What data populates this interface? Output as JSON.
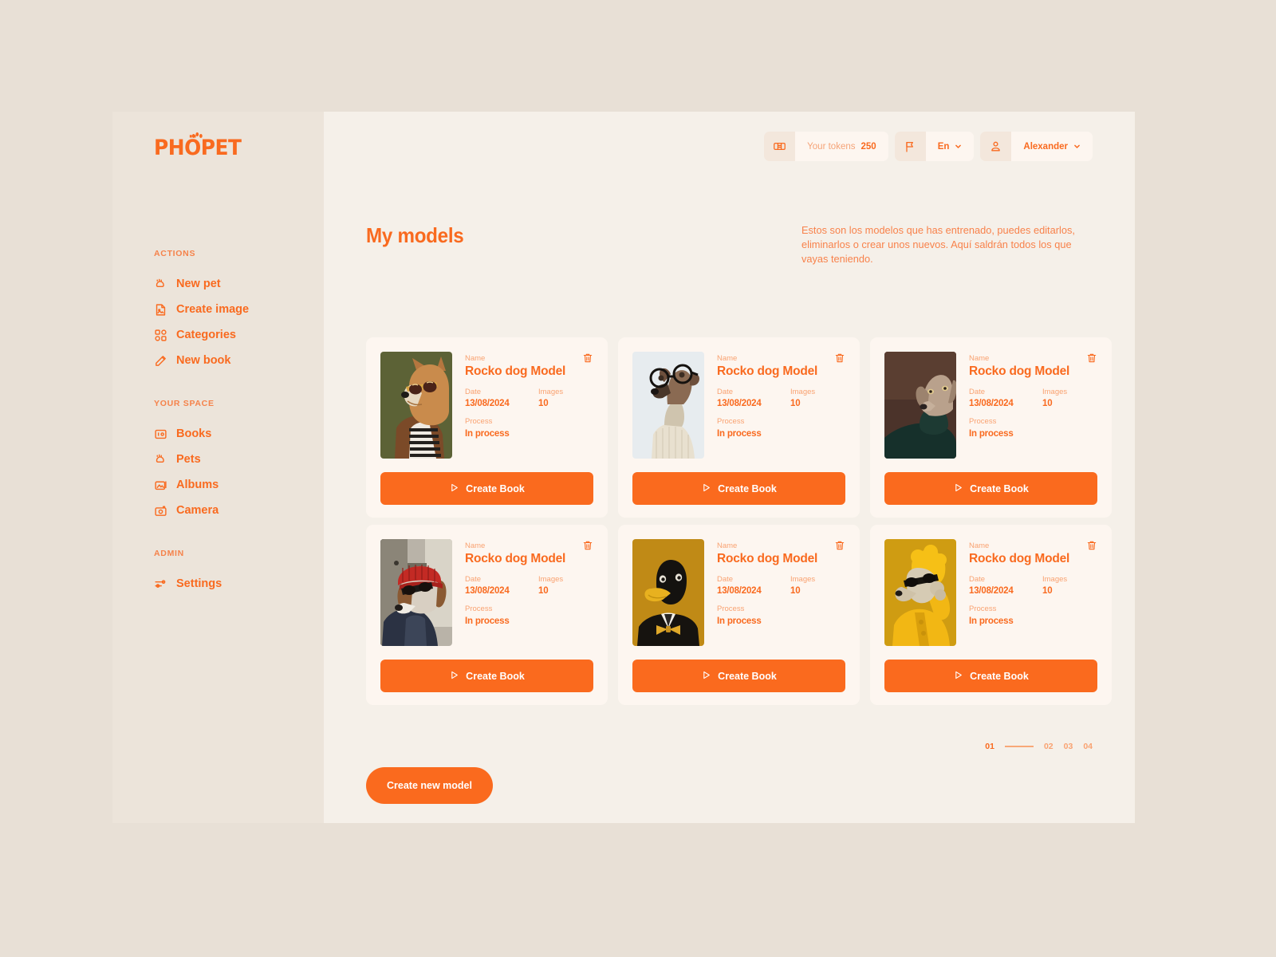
{
  "brand": {
    "name": "PHÖPET"
  },
  "header": {
    "tokens_label": "Your tokens",
    "tokens_value": "250",
    "language": "En",
    "user": "Alexander",
    "ticket_icon": "ticket-icon",
    "flag_icon": "flag-icon",
    "user_icon": "user-icon"
  },
  "sidebar": {
    "groups": [
      {
        "title": "ACTIONS",
        "items": [
          {
            "label": "New pet",
            "icon": "paw-icon"
          },
          {
            "label": "Create image",
            "icon": "image-file-icon"
          },
          {
            "label": "Categories",
            "icon": "grid-icon"
          },
          {
            "label": "New book",
            "icon": "pencil-icon"
          }
        ]
      },
      {
        "title": "YOUR SPACE",
        "items": [
          {
            "label": "Books",
            "icon": "book-icon"
          },
          {
            "label": "Pets",
            "icon": "paw-icon"
          },
          {
            "label": "Albums",
            "icon": "albums-icon"
          },
          {
            "label": "Camera",
            "icon": "camera-icon"
          }
        ]
      },
      {
        "title": "ADMIN",
        "items": [
          {
            "label": "Settings",
            "icon": "sliders-icon"
          }
        ]
      }
    ]
  },
  "main": {
    "title": "My models",
    "description": "Estos son los modelos que has entrenado, puedes editarlos, eliminarlos o crear unos nuevos. Aquí saldrán todos los que vayas teniendo.",
    "card_labels": {
      "name": "Name",
      "date": "Date",
      "images": "Images",
      "process": "Process"
    },
    "cta_label": "Create Book",
    "delete_icon": "trash-icon",
    "play_icon": "play-icon",
    "cards": [
      {
        "name": "Rocko dog Model",
        "date": "13/08/2024",
        "images": "10",
        "process": "In process",
        "thumb": "shiba-sunglasses-striped-shirt"
      },
      {
        "name": "Rocko dog Model",
        "date": "13/08/2024",
        "images": "10",
        "process": "In process",
        "thumb": "greyhound-round-glasses-sweater"
      },
      {
        "name": "Rocko dog Model",
        "date": "13/08/2024",
        "images": "10",
        "process": "In process",
        "thumb": "weimaraner-dark-turtleneck"
      },
      {
        "name": "Rocko dog Model",
        "date": "13/08/2024",
        "images": "10",
        "process": "In process",
        "thumb": "beagle-red-beanie-hoodie"
      },
      {
        "name": "Rocko dog Model",
        "date": "13/08/2024",
        "images": "10",
        "process": "In process",
        "thumb": "duck-suit-bowtie"
      },
      {
        "name": "Rocko dog Model",
        "date": "13/08/2024",
        "images": "10",
        "process": "In process",
        "thumb": "poodle-yellow-raincoat"
      }
    ],
    "pagination": {
      "pages": [
        "01",
        "02",
        "03",
        "04"
      ],
      "active": "01"
    },
    "create_new_label": "Create new model"
  },
  "colors": {
    "accent": "#fa6a1e",
    "accent_light": "#f9a271",
    "page_bg": "#e8e0d6",
    "sidebar_bg": "#ece4da",
    "main_bg": "#f5f0e9",
    "card_bg": "#fdf6f0"
  }
}
